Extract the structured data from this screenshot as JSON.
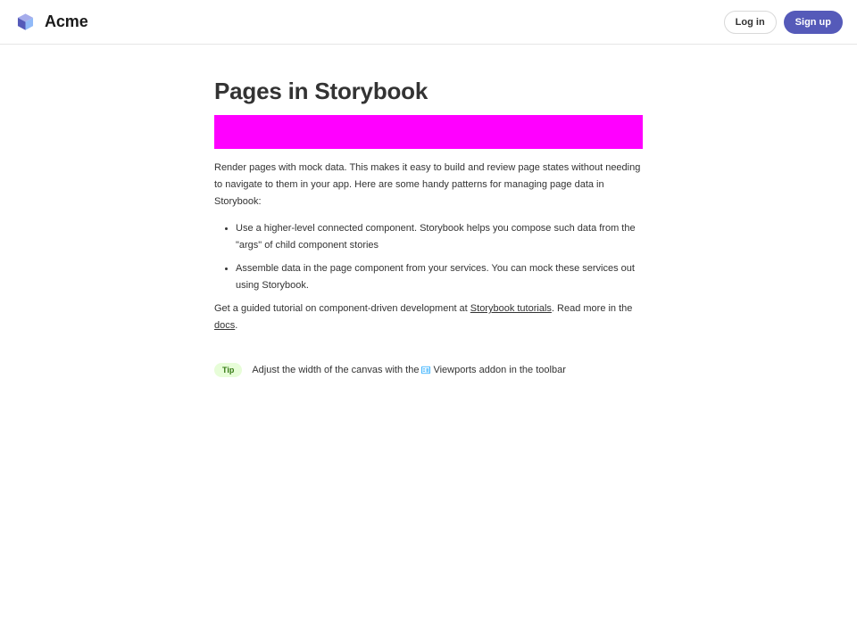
{
  "header": {
    "brand_name": "Acme",
    "login_label": "Log in",
    "signup_label": "Sign up"
  },
  "main": {
    "title": "Pages in Storybook",
    "intro": "Render pages with mock data. This makes it easy to build and review page states without needing to navigate to them in your app. Here are some handy patterns for managing page data in Storybook:",
    "list": [
      "Use a higher-level connected component. Storybook helps you compose such data from the \"args\" of child component stories",
      "Assemble data in the page component from your services. You can mock these services out using Storybook."
    ],
    "outro": {
      "prefix": "Get a guided tutorial on component-driven development at ",
      "tutorials_link": "Storybook tutorials",
      "middle": ". Read more in the ",
      "docs_link": "docs",
      "suffix": "."
    },
    "tip": {
      "badge": "Tip",
      "text_before": "Adjust the width of the canvas with the",
      "text_after": "Viewports addon in the toolbar",
      "icon": "viewport-icon"
    }
  },
  "colors": {
    "accent": "#555ab9",
    "banner": "#ff00ff",
    "tip_bg": "#e7fdd8",
    "tip_fg": "#357a14",
    "icon_blue": "#1ea7fd"
  }
}
